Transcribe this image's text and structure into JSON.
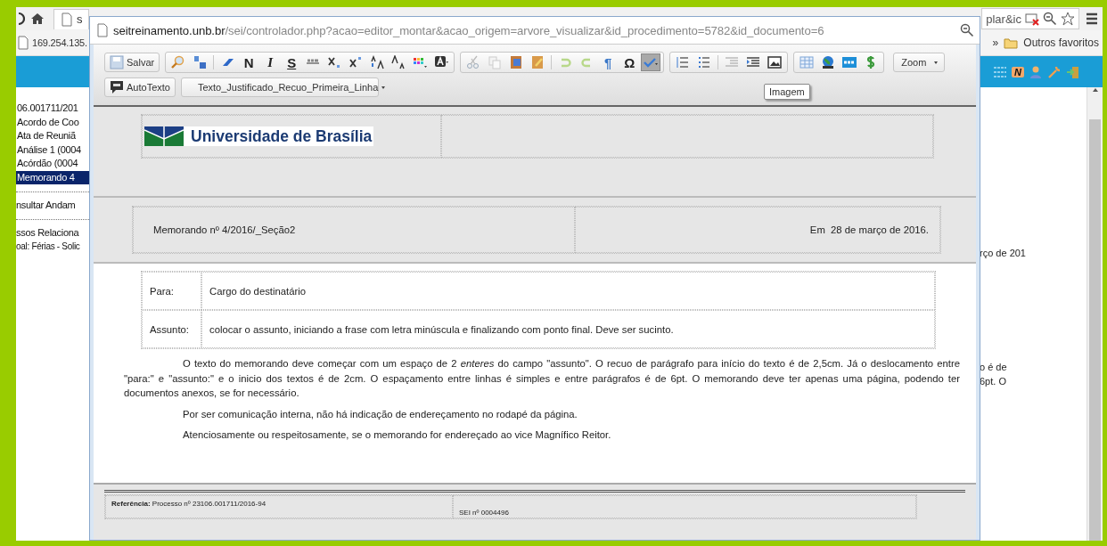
{
  "background_browser": {
    "tab_title": "s",
    "bookmark": "169.254.135.",
    "address_fragment": "plar&ic",
    "bookmarks_overflow": "»",
    "bookmark_folder": "Outros favoritos",
    "toolbar_badge": "N",
    "tree": [
      {
        "label": "06.001711/201",
        "selected": false
      },
      {
        "label": "Acordo de Coo",
        "selected": false
      },
      {
        "label": "Ata de Reuniã",
        "selected": false
      },
      {
        "label": "Análise 1 (0004",
        "selected": false
      },
      {
        "label": "Acórdão (0004",
        "selected": false
      },
      {
        "label": "Memorando 4",
        "selected": true
      }
    ],
    "links": [
      "nsultar Andam",
      "ssos Relaciona"
    ],
    "related": "oal: Férias - Solic",
    "right_texts": [
      "rço de 201",
      "o é de",
      "6pt. O"
    ]
  },
  "popup": {
    "url_host": "seitreinamento.unb.br",
    "url_path": "/sei/controlador.php?acao=editor_montar&acao_origem=arvore_visualizar&id_procedimento=5782&id_documento=6",
    "toolbar": {
      "save": "Salvar",
      "bold": "N",
      "italic": "I",
      "underline": "S",
      "paragraph": "¶",
      "special_char": "Ω",
      "spellcheck_pressed": true,
      "zoom": "Zoom",
      "autotext": "AutoTexto",
      "style": "Texto_Justificado_Recuo_Primeira_Linha",
      "tooltip": "Imagem"
    },
    "document": {
      "institution": "Universidade de Brasília",
      "memo_number": "Memorando nº 4/2016/_Seção2",
      "date": "Em  28 de março de 2016.",
      "address": [
        {
          "label": "Para:",
          "value": "Cargo do destinatário"
        },
        {
          "label": "Assunto:",
          "value": "colocar o assunto, iniciando a frase com letra minúscula e finalizando com ponto final. Deve ser sucinto."
        }
      ],
      "paragraphs": [
        {
          "kind": "indent",
          "text": "O texto do memorando deve começar com um espaço de 2 *enteres* do campo \"assunto\". O recuo de parágrafo para início do texto é de 2,5cm. Já o deslocamento entre \"para:\" e \"assunto:\" e o inicio dos textos é de 2cm. O espaçamento entre linhas é simples e entre parágrafos é de 6pt. O memorando deve ter apenas uma página, podendo ter documentos anexos, se for necessário."
        },
        {
          "kind": "offset",
          "text": "Por ser comunicação interna, não há indicação de endereçamento no rodapé da página."
        },
        {
          "kind": "offset",
          "text": "Atenciosamente ou respeitosamente, se o memorando for endereçado ao vice Magnífico Reitor."
        }
      ],
      "footer_reference": "**Referência:** Processo nº 23106.001711/2016-94",
      "footer_sei": "SEI nº 0004496"
    }
  }
}
